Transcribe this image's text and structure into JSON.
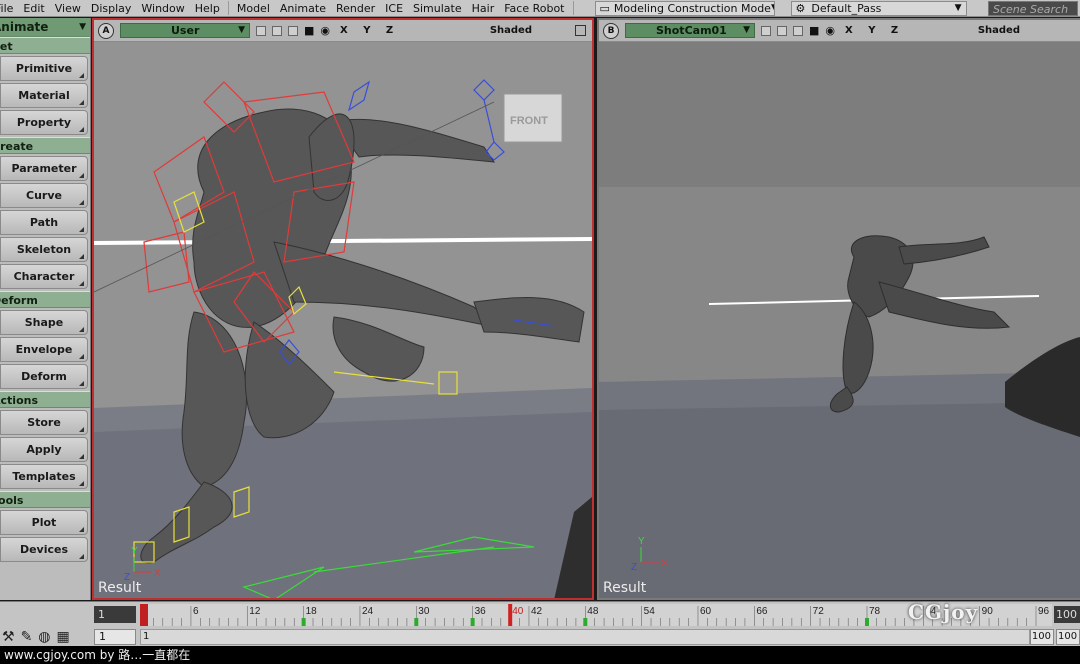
{
  "menubar": {
    "items": [
      "File",
      "Edit",
      "View",
      "Display",
      "Window",
      "Help",
      "Model",
      "Animate",
      "Render",
      "ICE",
      "Simulate",
      "Hair",
      "Face Robot"
    ],
    "mode_combo": "Modeling Construction Mode",
    "pass_combo": "Default_Pass",
    "search_placeholder": "Scene Search"
  },
  "left_toolbar": {
    "panel": "Animate",
    "sections": [
      {
        "header": "Set",
        "buttons": [
          "Primitive",
          "Material",
          "Property"
        ]
      },
      {
        "header": "Create",
        "buttons": [
          "Parameter",
          "Curve",
          "Path",
          "Skeleton",
          "Character"
        ]
      },
      {
        "header": "Deform",
        "buttons": [
          "Shape",
          "Envelope",
          "Deform"
        ]
      },
      {
        "header": "Actions",
        "buttons": [
          "Store",
          "Apply",
          "Templates"
        ]
      },
      {
        "header": "Tools",
        "buttons": [
          "Plot",
          "Devices"
        ]
      }
    ]
  },
  "viewport_a": {
    "letter": "A",
    "camera": "User",
    "axes": "X Y Z",
    "display": "Shaded",
    "label": "Result",
    "cube_label": "FRONT"
  },
  "viewport_b": {
    "letter": "B",
    "camera": "ShotCam01",
    "axes": "X Y Z",
    "display": "Shaded",
    "label": "Result"
  },
  "timeline": {
    "start": "1",
    "in": "1",
    "range_start": "1",
    "ticks": [
      "6",
      "12",
      "18",
      "24",
      "30",
      "36",
      "40",
      "42",
      "48",
      "54",
      "60",
      "66",
      "72",
      "78",
      "84",
      "90",
      "96"
    ],
    "current_frame": 40,
    "end": "100",
    "range_end": "100",
    "range_end_2": "100"
  },
  "logo": "CGjoy",
  "footer": "www.cgjoy.com by 路…一直都在",
  "colors": {
    "menubar": "#c8c8c8",
    "section_header": "#8eaf92",
    "active_border": "#c03030",
    "viewport_sky": "#959595",
    "viewport_ground": "#6e707a",
    "rig_red": "#e03a3a",
    "rig_yellow": "#e8e03a",
    "rig_blue": "#3a4ed8",
    "rig_green": "#3adc3a"
  }
}
